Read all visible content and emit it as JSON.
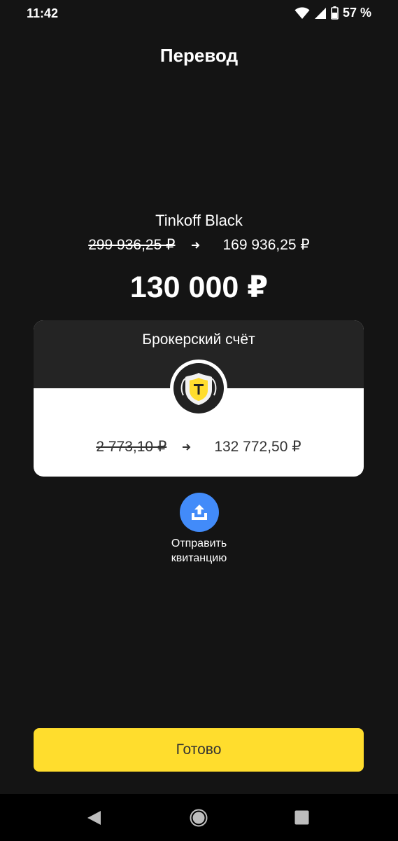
{
  "status_bar": {
    "time": "11:42",
    "battery": "57 %",
    "icons": [
      "wifi-icon",
      "signal-icon",
      "battery-icon"
    ]
  },
  "title": "Перевод",
  "source": {
    "name": "Tinkoff Black",
    "old_balance": "299 936,25 ₽",
    "new_balance": "169 936,25 ₽"
  },
  "amount": "130 000 ₽",
  "destination": {
    "name": "Брокерский счёт",
    "old_balance": "2 773,10 ₽",
    "new_balance": "132 772,50 ₽",
    "logo_icon": "tinkoff-emblem-icon"
  },
  "receipt": {
    "label_line1": "Отправить",
    "label_line2": "квитанцию",
    "icon": "upload-icon"
  },
  "done_button": "Готово",
  "colors": {
    "background": "#141414",
    "card_top": "#242424",
    "accent_yellow": "#ffdd2d",
    "receipt_blue": "#428bf9"
  },
  "nav_bar": {
    "icons": [
      "back-icon",
      "home-icon",
      "recents-icon"
    ]
  }
}
